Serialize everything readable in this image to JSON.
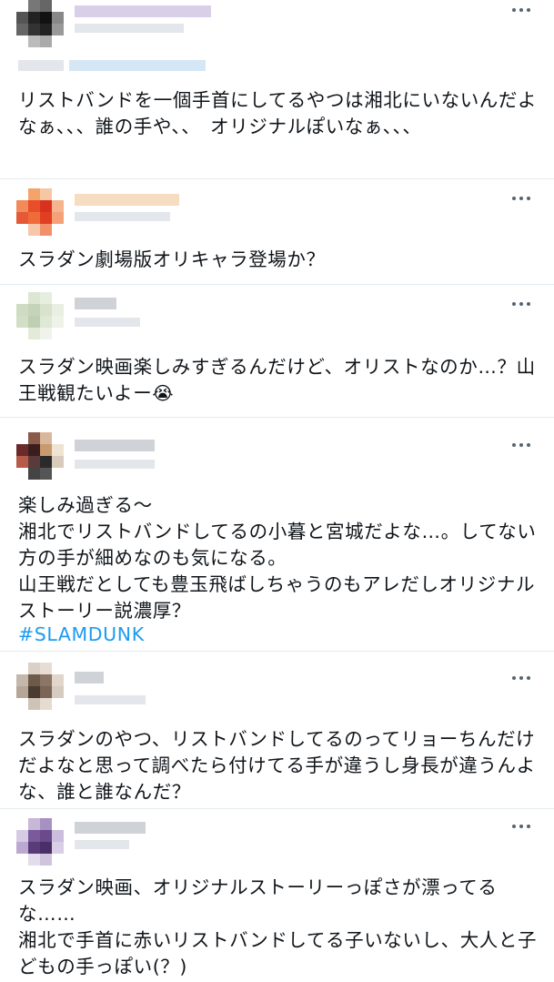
{
  "tweets": [
    {
      "text": "リストバンドを一個手首にしてるやつは湘北にいないんだよなぁ、、、誰の手や、、　オリジナルぽいなぁ、、、"
    },
    {
      "text": "スラダン劇場版オリキャラ登場か？"
    },
    {
      "text": "スラダン映画楽しみすぎるんだけど、オリストなのか…？山王戦観たいよー",
      "emoji": "😭"
    },
    {
      "text": "楽しみ過ぎる〜\n湘北でリストバンドしてるの小暮と宮城だよな…。してない方の手が細めなのも気になる。\n山王戦だとしても豊玉飛ばしちゃうのもアレだしオリジナルストーリー説濃厚？",
      "hashtag": "#SLAMDUNK"
    },
    {
      "text": "スラダンのやつ、リストバンドしてるのってリョーちんだけだよなと思って調べたら付けてる手が違うし身長が違うんよな、誰と誰なんだ？"
    },
    {
      "text": "スラダン映画、オリジナルストーリーっぽさが漂ってるな……\n湘北で手首に赤いリストバンドしてる子いないし、大人と子どもの手っぽい(？)"
    }
  ],
  "icons": {
    "more": "more-dots-icon",
    "avatar": "pixelated-avatar"
  },
  "colors": {
    "hashtag": "#1d9bf0",
    "divider": "#e6ecf0",
    "text": "#0f1419"
  }
}
